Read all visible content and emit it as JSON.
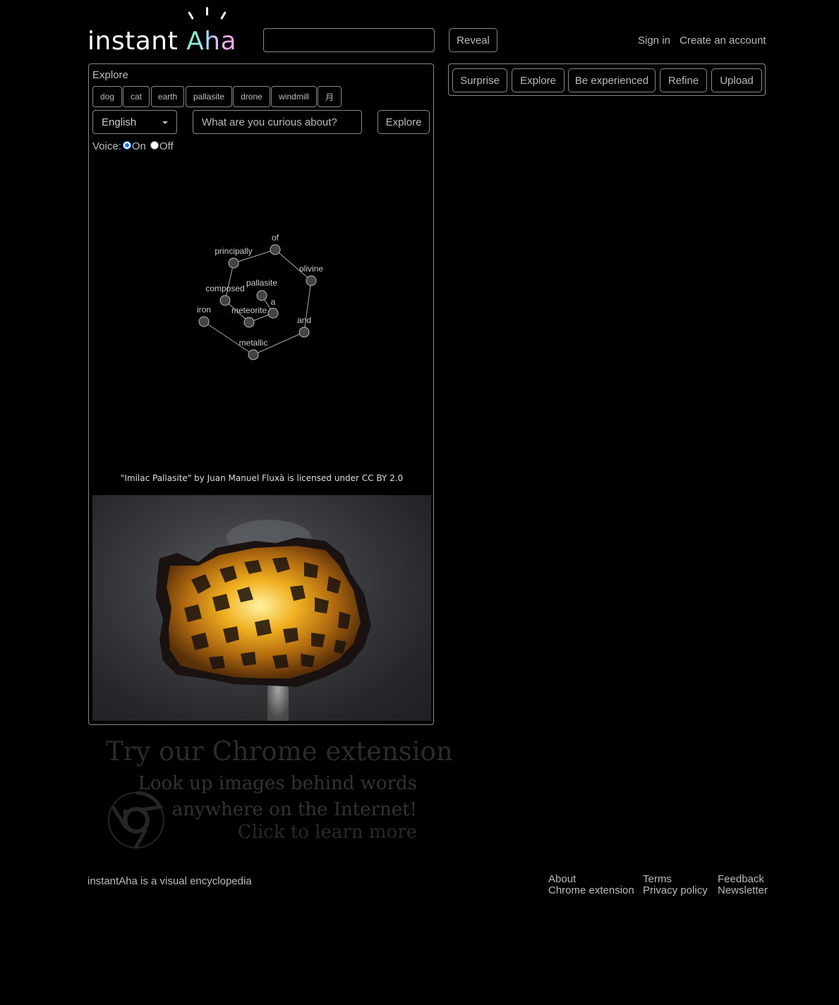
{
  "header": {
    "logo_text_plain": "instant",
    "logo_text_accent": "Aha",
    "reveal_button": "Reveal",
    "sign_in": "Sign in",
    "create_account": "Create an account"
  },
  "toolbar": {
    "buttons": [
      "Surprise",
      "Explore",
      "Be experienced",
      "Refine",
      "Upload"
    ]
  },
  "explore_panel": {
    "title": "Explore",
    "chips": [
      "dog",
      "cat",
      "earth",
      "pallasite",
      "drone",
      "windmill",
      "月"
    ],
    "language": "English",
    "search_placeholder": "What are you curious about?",
    "explore_button": "Explore",
    "voice_label": "Voice:",
    "voice_on": "On",
    "voice_off": "Off",
    "voice_selected": "On"
  },
  "word_graph": {
    "nodes": [
      {
        "id": "of",
        "label": "of"
      },
      {
        "id": "principally",
        "label": "principally"
      },
      {
        "id": "olivine",
        "label": "olivine"
      },
      {
        "id": "composed",
        "label": "composed"
      },
      {
        "id": "pallasite",
        "label": "pallasite"
      },
      {
        "id": "a",
        "label": "a"
      },
      {
        "id": "meteorite",
        "label": "meteorite"
      },
      {
        "id": "iron",
        "label": "iron"
      },
      {
        "id": "and",
        "label": "and"
      },
      {
        "id": "metallic",
        "label": "metallic"
      }
    ],
    "edges": [
      [
        "principally",
        "of"
      ],
      [
        "of",
        "olivine"
      ],
      [
        "olivine",
        "and"
      ],
      [
        "and",
        "metallic"
      ],
      [
        "metallic",
        "iron"
      ],
      [
        "principally",
        "composed"
      ],
      [
        "composed",
        "meteorite"
      ],
      [
        "meteorite",
        "a"
      ],
      [
        "a",
        "pallasite"
      ]
    ]
  },
  "image": {
    "credit": "\"Imilac Pallasite\" by Juan Manuel Fluxà is licensed under CC BY 2.0"
  },
  "promo": {
    "title": "Try our Chrome extension",
    "line1": "Look up images behind words",
    "line2": "anywhere on the Internet!",
    "cta": "Click to learn more"
  },
  "footer": {
    "tagline": "instantAha is a visual encyclopedia",
    "links": [
      "About",
      "Chrome extension",
      "Terms",
      "Privacy policy",
      "Feedback",
      "Newsletter"
    ]
  },
  "colors": {
    "background": "#000000",
    "text": "#bbbbbb",
    "border": "#888888",
    "radio_accent": "#1a73e8"
  }
}
